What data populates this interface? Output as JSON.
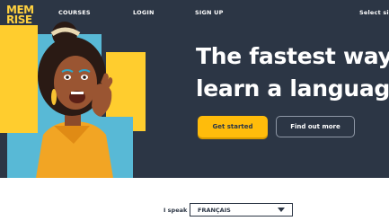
{
  "brand": {
    "logo_line1": "MEM",
    "logo_line2": "RISE",
    "logo_color": "#ffd13f"
  },
  "nav": {
    "courses": "COURSES",
    "login": "LOGIN",
    "signup": "SIGN UP",
    "select_site": "Select site"
  },
  "hero": {
    "headline_line1": "The fastest way",
    "headline_line2": "learn a language",
    "background_color": "#2c3645",
    "illustration": "smiling-woman-calling-out"
  },
  "buttons": {
    "get_started": "Get started",
    "find_out_more": "Find out more",
    "primary_color": "#ffbc0b"
  },
  "language": {
    "label": "I speak",
    "selected": "FRANÇAIS"
  }
}
